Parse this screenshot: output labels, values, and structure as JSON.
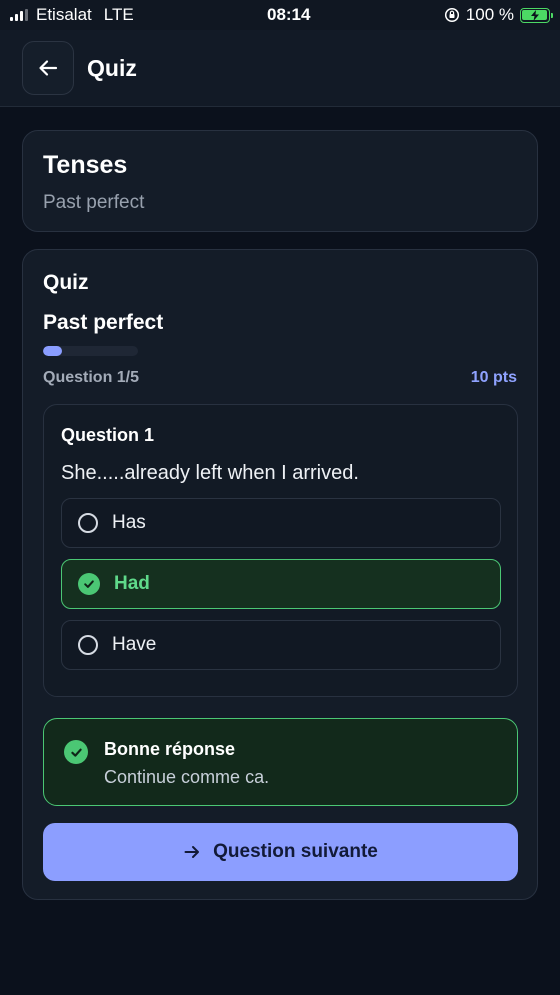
{
  "status_bar": {
    "carrier": "Etisalat",
    "network": "LTE",
    "time": "08:14",
    "battery": "100 %"
  },
  "header": {
    "title": "Quiz",
    "back_icon": "arrow-left-icon"
  },
  "topic": {
    "title": "Tenses",
    "subtitle": "Past perfect"
  },
  "quiz": {
    "label": "Quiz",
    "name": "Past perfect",
    "progress_fraction": 0.2,
    "counter": "Question 1/5",
    "points": "10 pts",
    "question": {
      "title": "Question 1",
      "text": "She.....already left when I arrived.",
      "options": [
        {
          "label": "Has",
          "state": "unselected"
        },
        {
          "label": "Had",
          "state": "correct"
        },
        {
          "label": "Have",
          "state": "unselected"
        }
      ]
    },
    "feedback": {
      "title": "Bonne réponse",
      "message": "Continue comme ca."
    },
    "next_button_label": "Question suivante"
  },
  "colors": {
    "accent": "#8c9eff",
    "success": "#4bc774",
    "background": "#0b111c"
  }
}
